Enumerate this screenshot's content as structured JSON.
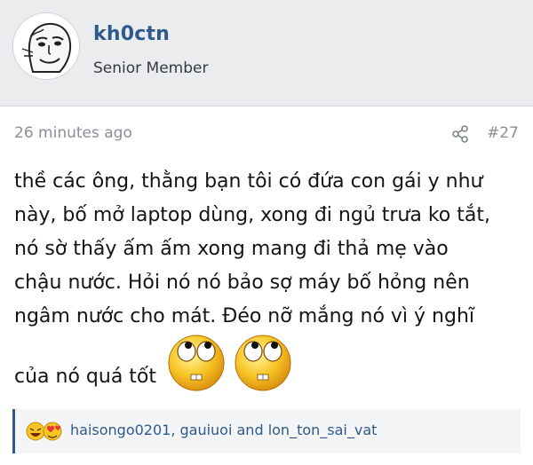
{
  "user": {
    "name": "kh0ctn",
    "title": "Senior Member"
  },
  "post": {
    "time": "26 minutes ago",
    "number": "#27",
    "body_lines": [
      "thề các ông, thằng bạn tôi có đứa con gái y như",
      "này, bố mở laptop dùng, xong đi ngủ trưa ko tắt,",
      "nó sờ thấy ấm ấm xong mang đi thả mẹ vào",
      "chậu nước. Hỏi nó nó bảo sợ máy bố hỏng nên",
      "ngâm nước cho mát. Đéo nỡ mắng nó vì ý nghĩ"
    ],
    "last_line": "của nó quá tốt",
    "emojis": [
      "eye-roll-emoji",
      "eye-roll-emoji"
    ]
  },
  "reactions": {
    "icons": [
      "laugh-reaction-icon",
      "love-reaction-icon"
    ],
    "users": "haisongo0201, gauiuoi and lon_ton_sai_vat"
  },
  "colors": {
    "accent": "#2d5a8c",
    "header_bg": "#ebecee",
    "meta_text": "#8a8f96"
  }
}
